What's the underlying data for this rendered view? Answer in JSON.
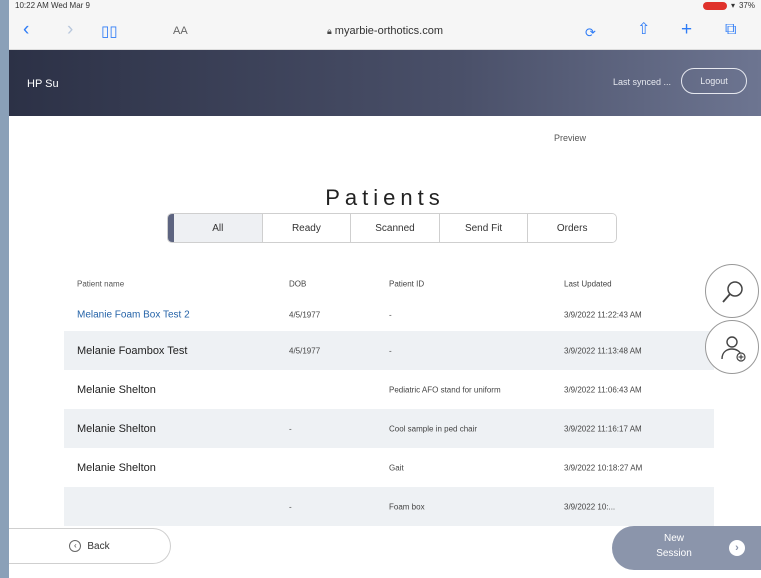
{
  "status_bar": {
    "time": "10:22 AM  Wed Mar 9",
    "battery": "37%"
  },
  "browser": {
    "text_size_label": "AA",
    "url": "myarbie-orthotics.com"
  },
  "header": {
    "user": "HP Su",
    "sync_text": "Last synced ...",
    "logout_label": "Logout"
  },
  "preview_link": "Preview",
  "page_title": "Patients",
  "tabs": [
    {
      "label": "All",
      "active": true
    },
    {
      "label": "Ready",
      "active": false
    },
    {
      "label": "Scanned",
      "active": false
    },
    {
      "label": "Send Fit",
      "active": false
    },
    {
      "label": "Orders",
      "active": false
    }
  ],
  "table": {
    "headers": [
      "Patient name",
      "DOB",
      "Patient ID",
      "Last Updated"
    ],
    "rows": [
      {
        "name": "Melanie Foam Box Test 2",
        "dob": "4/5/1977",
        "pid": "-",
        "updated": "3/9/2022 11:22:43 AM"
      },
      {
        "name": "Melanie Foambox Test",
        "dob": "4/5/1977",
        "pid": "-",
        "updated": "3/9/2022 11:13:48 AM"
      },
      {
        "name": "Melanie Shelton",
        "dob": "",
        "pid": "Pediatric AFO stand for uniform",
        "updated": "3/9/2022 11:06:43 AM"
      },
      {
        "name": "Melanie Shelton",
        "dob": "-",
        "pid": "Cool sample in ped chair",
        "updated": "3/9/2022 11:16:17 AM"
      },
      {
        "name": "Melanie Shelton",
        "dob": "",
        "pid": "Gait",
        "updated": "3/9/2022 10:18:27 AM"
      },
      {
        "name": "",
        "dob": "-",
        "pid": "Foam box",
        "updated": "3/9/2022 10:..."
      }
    ]
  },
  "buttons": {
    "back": "Back",
    "new_session_line1": "New",
    "new_session_line2": "Session"
  },
  "icons": {
    "search": "search-icon",
    "add_patient": "add-patient-icon"
  }
}
